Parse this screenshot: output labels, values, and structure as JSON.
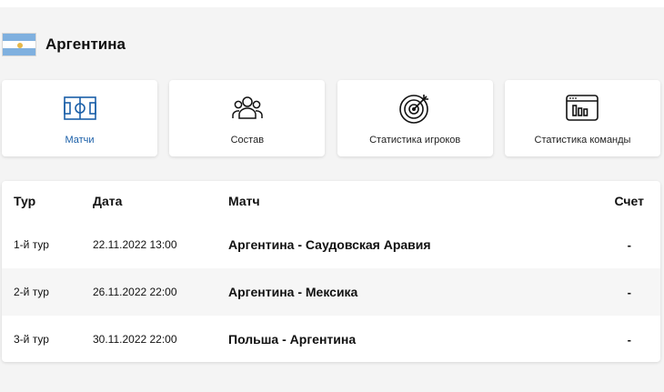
{
  "team": {
    "name": "Аргентина",
    "flag_icon": "argentina-flag"
  },
  "tabs": [
    {
      "label": "Матчи",
      "icon": "field-icon",
      "active": true
    },
    {
      "label": "Состав",
      "icon": "users-icon",
      "active": false
    },
    {
      "label": "Статистика игроков",
      "icon": "target-icon",
      "active": false
    },
    {
      "label": "Статистика команды",
      "icon": "stats-window-icon",
      "active": false
    }
  ],
  "table": {
    "headers": {
      "round": "Тур",
      "date": "Дата",
      "match": "Матч",
      "score": "Счет"
    },
    "rows": [
      {
        "round": "1-й тур",
        "date": "22.11.2022 13:00",
        "match": "Аргентина - Саудовская Аравия",
        "score": "-"
      },
      {
        "round": "2-й тур",
        "date": "26.11.2022 22:00",
        "match": "Аргентина - Мексика",
        "score": "-"
      },
      {
        "round": "3-й тур",
        "date": "30.11.2022 22:00",
        "match": "Польша - Аргентина",
        "score": "-"
      }
    ]
  },
  "colors": {
    "accent": "#1a5fa8",
    "background": "#f4f4f4",
    "card": "#ffffff"
  }
}
